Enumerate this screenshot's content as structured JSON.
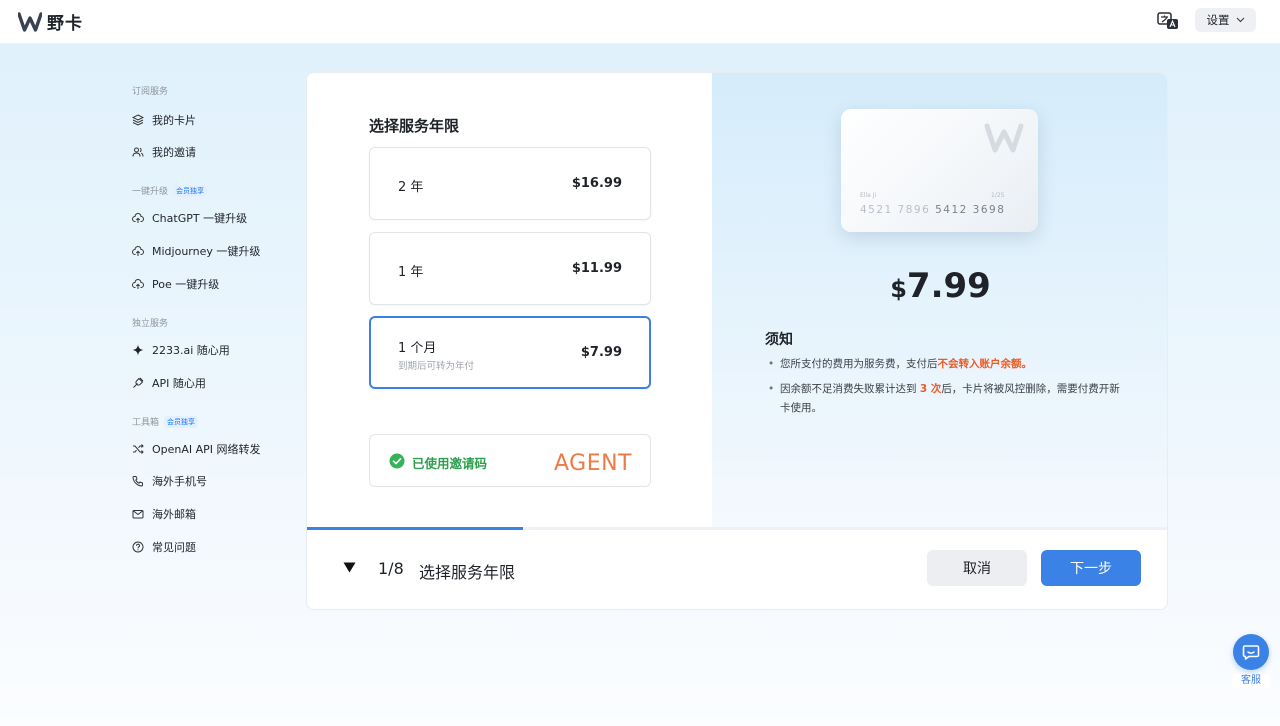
{
  "header": {
    "logo_letter": "W",
    "logo_text": "野卡",
    "settings_label": "设置",
    "icons": [
      "w-logo-icon",
      "translate-icon",
      "chevron-down-icon"
    ]
  },
  "sidebar": {
    "sections": [
      {
        "title": "订阅服务",
        "badge": ""
      },
      {
        "title": "一键升级",
        "badge": "会员独享"
      },
      {
        "title": "独立服务",
        "badge": ""
      },
      {
        "title": "工具箱",
        "badge": "会员独享"
      }
    ],
    "items": [
      {
        "label": "我的卡片",
        "icon": "card-stack-icon"
      },
      {
        "label": "我的邀请",
        "icon": "users-icon"
      },
      {
        "label": "ChatGPT 一键升级",
        "icon": "cloud-upload-icon"
      },
      {
        "label": "Midjourney 一键升级",
        "icon": "cloud-upload-icon"
      },
      {
        "label": "Poe 一键升级",
        "icon": "cloud-upload-icon"
      },
      {
        "label": "2233.ai 随心用",
        "icon": "sparkle-icon"
      },
      {
        "label": "API 随心用",
        "icon": "plug-icon"
      },
      {
        "label": "OpenAI API 网络转发",
        "icon": "shuffle-icon"
      },
      {
        "label": "海外手机号",
        "icon": "phone-icon"
      },
      {
        "label": "海外邮箱",
        "icon": "mail-icon"
      },
      {
        "label": "常见问题",
        "icon": "help-circle-icon"
      }
    ]
  },
  "plan": {
    "heading": "选择服务年限",
    "options": [
      {
        "label": "2 年",
        "price": "$16.99",
        "sub": "",
        "selected": false
      },
      {
        "label": "1 年",
        "price": "$11.99",
        "sub": "",
        "selected": false
      },
      {
        "label": "1 个月",
        "price": "$7.99",
        "sub": "到期后可转为年付",
        "selected": true
      }
    ],
    "invite_text": "已使用邀请码",
    "invite_code": "AGENT"
  },
  "card_preview": {
    "name": "Ella Ji",
    "expiry": "1/25",
    "number_masked": "4521 7896 ",
    "number_visible": "5412 3698",
    "price_currency": "$",
    "price_amount": "7.99"
  },
  "notice": {
    "title": "须知",
    "item1_text": "您所支付的费用为服务费，支付后",
    "item1_warn": "不会转入账户余额。",
    "item2_text_a": "因余额不足消费失败累计达到 ",
    "item2_warn": "3 次",
    "item2_text_b": "后，卡片将被风控删除，需要付费开新卡使用。"
  },
  "footer": {
    "step_count": "1/8",
    "step_title": "选择服务年限",
    "progress_fraction": 0.125,
    "cancel_label": "取消",
    "next_label": "下一步"
  },
  "support": {
    "label": "客服"
  },
  "colors": {
    "accent": "#3b82e6",
    "success": "#2e9e4f",
    "warning": "#ee5a24",
    "agent": "#ee7a48"
  }
}
